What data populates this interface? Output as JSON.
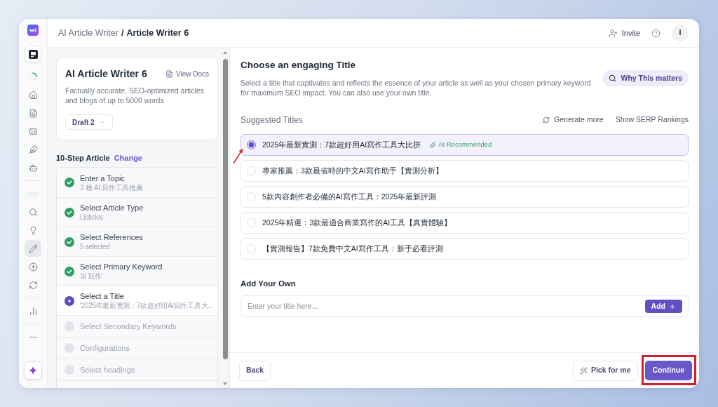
{
  "nav_rail": {
    "groups": [
      {
        "items": [
          {
            "kind": "panel",
            "selected": false
          },
          {
            "kind": "loading"
          },
          {
            "kind": "home",
            "selected": false
          },
          {
            "kind": "document",
            "selected": false
          },
          {
            "kind": "captions",
            "selected": false
          },
          {
            "kind": "feather",
            "selected": false
          },
          {
            "kind": "bot",
            "selected": false
          }
        ]
      },
      {
        "items": [
          {
            "kind": "skeleton"
          },
          {
            "kind": "search",
            "selected": false
          },
          {
            "kind": "bulb",
            "selected": false
          },
          {
            "kind": "pencil",
            "selected": true
          },
          {
            "kind": "upload",
            "selected": false
          },
          {
            "kind": "refresh",
            "selected": false
          }
        ]
      },
      {
        "items": [
          {
            "kind": "chart",
            "selected": false
          }
        ]
      },
      {
        "items": [
          {
            "kind": "more",
            "selected": false
          }
        ]
      }
    ]
  },
  "breadcrumb": {
    "parent": "AI Article Writer",
    "separator": "/",
    "current": "Article Writer 6"
  },
  "header_actions": {
    "invite": "Invite",
    "avatar": "I"
  },
  "tool_card": {
    "title": "AI Article Writer 6",
    "docs_link": "View Docs",
    "description": "Factually accurate, SEO-optimized articles and blogs of up to 5000 words",
    "draft": "Draft 2"
  },
  "steps": {
    "heading": "10-Step Article",
    "change_link": "Change",
    "items": [
      {
        "title": "Enter a Topic",
        "detail": "3 種 AI 寫作工具推薦",
        "completed": true,
        "active": false
      },
      {
        "title": "Select Article Type",
        "detail": "Listicles",
        "completed": true,
        "active": false
      },
      {
        "title": "Select References",
        "detail": "5 selected",
        "completed": true,
        "active": false
      },
      {
        "title": "Select Primary Keyword",
        "detail": "'ai 寫作'",
        "completed": true,
        "active": false
      },
      {
        "title": "Select a Title",
        "detail": "'2025年最新實測：7款超好用AI寫作工具大...",
        "completed": false,
        "active": true
      },
      {
        "title": "Select Secondary Keywords",
        "completed": false,
        "active": false
      },
      {
        "title": "Configurations",
        "completed": false,
        "active": false
      },
      {
        "title": "Select headings",
        "completed": false,
        "active": false
      }
    ]
  },
  "title_step": {
    "heading": "Choose an engaging Title",
    "description": "Select a title that captivates and reflects the essence of your article as well as your chosen primary keyword for maximum SEO impact. You can also use your own title.",
    "why_button": "Why This matters"
  },
  "suggested": {
    "heading": "Suggested Titles",
    "generate_more": "Generate more",
    "serp_link": "Show SERP Rankings",
    "options": [
      {
        "text": "2025年最新實測：7款超好用AI寫作工具大比拼",
        "badge": "AI Recommended",
        "selected": true
      },
      {
        "text": "專家推薦：3款最省時的中文AI寫作助手【實測分析】",
        "selected": false
      },
      {
        "text": "5款內容創作者必備的AI寫作工具：2025年最新評測",
        "selected": false
      },
      {
        "text": "2025年精選：3款最適合商業寫作的AI工具【真實體驗】",
        "selected": false
      },
      {
        "text": "【實測報告】7款免費中文AI寫作工具：新手必看評測",
        "selected": false
      }
    ]
  },
  "add_own": {
    "heading": "Add Your Own",
    "placeholder": "Enter your title here...",
    "add_button": "Add"
  },
  "footer": {
    "back": "Back",
    "pick": "Pick for me",
    "continue": "Continue"
  }
}
